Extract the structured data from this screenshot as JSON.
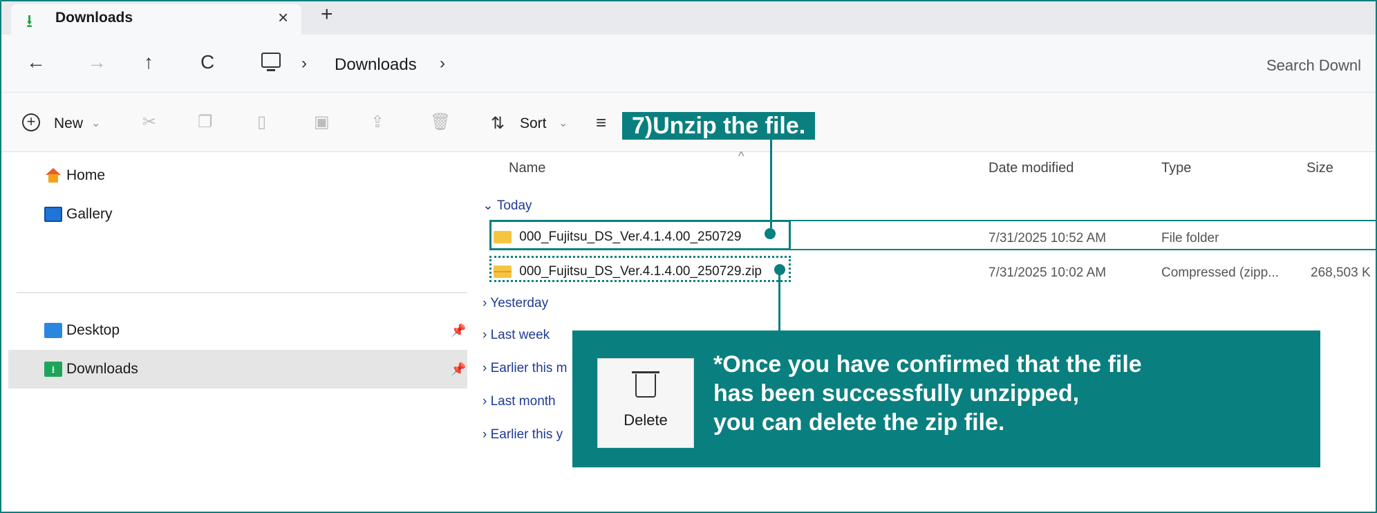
{
  "tab": {
    "title": "Downloads",
    "close": "×",
    "new": "+"
  },
  "nav": {
    "back": "←",
    "forward": "→",
    "up": "↑",
    "refresh": "C",
    "sep": "›",
    "crumb": "Downloads",
    "search_placeholder": "Search Downl"
  },
  "toolbar": {
    "new_label": "New",
    "sort_label": "Sort",
    "chevron": "⌄"
  },
  "callouts": {
    "step": "7)Unzip the file.",
    "note_lines": [
      "*Once you have confirmed that the file",
      "has been successfully unzipped,",
      "you can delete the zip file."
    ],
    "delete_label": "Delete"
  },
  "sidebar": {
    "items": [
      {
        "label": "Home"
      },
      {
        "label": "Gallery"
      },
      {
        "label": "Desktop"
      },
      {
        "label": "Downloads"
      }
    ]
  },
  "list": {
    "columns": {
      "name": "Name",
      "date": "Date modified",
      "type": "Type",
      "size": "Size"
    },
    "groups": {
      "today": "Today",
      "yesterday": "Yesterday",
      "last_week": "Last week",
      "earlier_month": "Earlier this m",
      "last_month": "Last month",
      "earlier_year": "Earlier this y"
    },
    "rows": [
      {
        "name": "000_Fujitsu_DS_Ver.4.1.4.00_250729",
        "date": "7/31/2025 10:52 AM",
        "type": "File folder",
        "size": ""
      },
      {
        "name": "000_Fujitsu_DS_Ver.4.1.4.00_250729.zip",
        "date": "7/31/2025 10:02 AM",
        "type": "Compressed (zipp...",
        "size": "268,503 K"
      }
    ]
  },
  "colors": {
    "accent": "#0a7f7f"
  }
}
